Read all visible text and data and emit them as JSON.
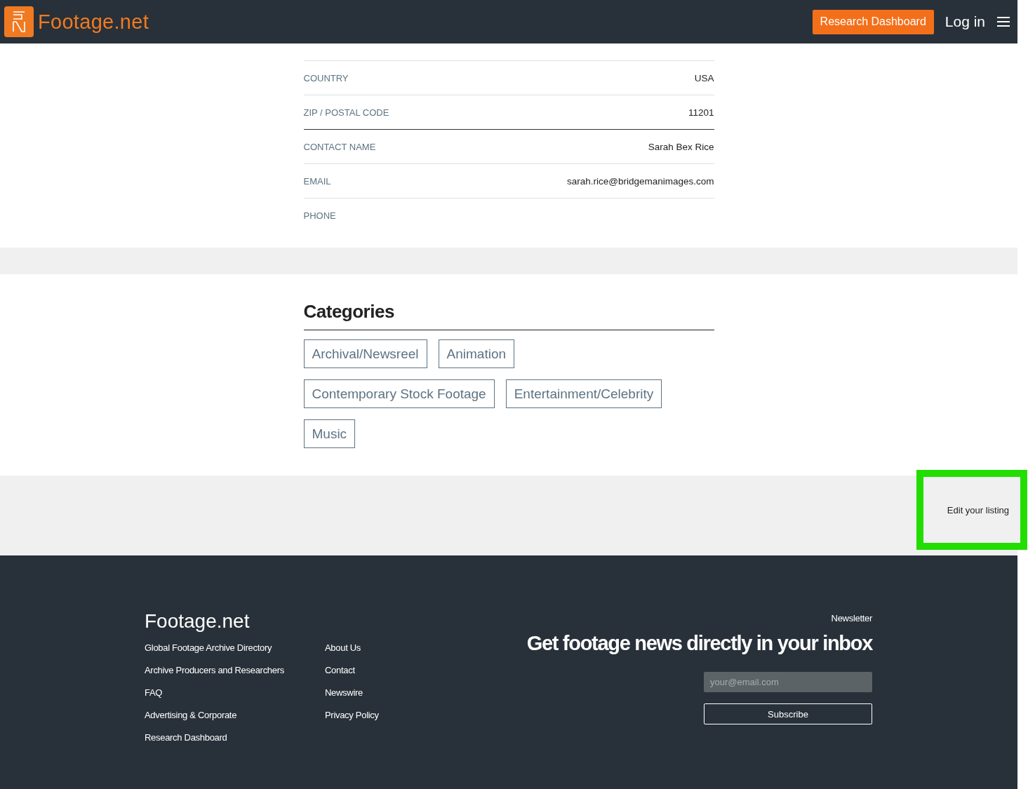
{
  "header": {
    "logo_text": "Footage.net",
    "dashboard_button": "Research Dashboard",
    "login": "Log in"
  },
  "address": [
    {
      "label": "COUNTRY",
      "value": "USA"
    },
    {
      "label": "ZIP / POSTAL CODE",
      "value": "11201"
    }
  ],
  "contact": [
    {
      "label": "CONTACT NAME",
      "value": "Sarah Bex Rice"
    },
    {
      "label": "EMAIL",
      "value": "sarah.rice@bridgemanimages.com"
    },
    {
      "label": "PHONE"
    }
  ],
  "categories": {
    "title": "Categories",
    "tags": [
      "Archival/Newsreel",
      "Animation",
      "Contemporary Stock Footage",
      "Entertainment/Celebrity",
      "Music"
    ]
  },
  "edit_listing": {
    "label": "Edit your listing",
    "highlighted": true
  },
  "footer": {
    "brand": "Footage.net",
    "links_left": [
      "Global Footage Archive Directory",
      "Archive Producers and Researchers",
      "FAQ",
      "Advertising & Corporate",
      "Research Dashboard"
    ],
    "links_right": [
      "About Us",
      "Contact",
      "Newswire",
      "Privacy Policy"
    ],
    "newsletter": {
      "label": "Newsletter",
      "heading": "Get footage news directly in your inbox",
      "placeholder": "your@email.com",
      "button": "Subscribe"
    }
  }
}
